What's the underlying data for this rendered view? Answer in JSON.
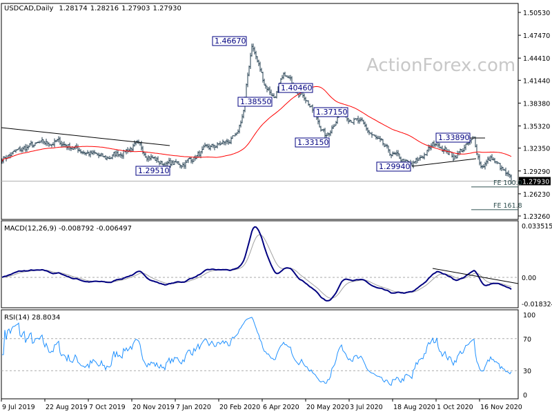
{
  "chart_data": {
    "type": "line",
    "title": "USDCAD,Daily",
    "ohlc_last": [
      "1.28174",
      "1.28216",
      "1.27903",
      "1.27930"
    ],
    "watermark": "ActionForex.com",
    "x_tick_labels": [
      "9 Jul 2019",
      "22 Aug 2019",
      "7 Oct 2019",
      "20 Nov 2019",
      "7 Jan 2020",
      "20 Feb 2020",
      "6 Apr 2020",
      "20 May 2020",
      "3 Jul 2020",
      "18 Aug 2020",
      "1 Oct 2020",
      "16 Nov 2020"
    ],
    "price_panel": {
      "y_ticks": [
        "1.50530",
        "1.47470",
        "1.44410",
        "1.41440",
        "1.38380",
        "1.35320",
        "1.32350",
        "1.29290",
        "1.26230",
        "1.23260"
      ],
      "ylim": [
        1.2326,
        1.5053
      ],
      "current_price": "1.27930",
      "close_anchors_by_bar": [
        [
          0,
          1.31
        ],
        [
          20,
          1.326
        ],
        [
          40,
          1.332
        ],
        [
          75,
          1.309
        ],
        [
          97,
          1.327
        ],
        [
          115,
          1.303
        ],
        [
          130,
          1.302
        ],
        [
          150,
          1.323
        ],
        [
          170,
          1.337
        ],
        [
          175,
          1.374
        ],
        [
          181,
          1.463
        ],
        [
          190,
          1.411
        ],
        [
          197,
          1.392
        ],
        [
          205,
          1.42
        ],
        [
          220,
          1.392
        ],
        [
          235,
          1.337
        ],
        [
          245,
          1.374
        ],
        [
          260,
          1.356
        ],
        [
          280,
          1.318
        ],
        [
          297,
          1.299
        ],
        [
          315,
          1.332
        ],
        [
          327,
          1.312
        ],
        [
          342,
          1.334
        ],
        [
          347,
          1.3
        ],
        [
          355,
          1.31
        ],
        [
          369,
          1.2793
        ]
      ],
      "moving_average_color": "#ff0000",
      "bar_color": "#1f3b4d",
      "annotations": [
        "1.46670",
        "1.38550",
        "1.40460",
        "1.37150",
        "1.33150",
        "1.29510",
        "1.29940",
        "1.33890"
      ],
      "fib_levels": [
        {
          "label": "FE 100.0",
          "price": 1.2715
        },
        {
          "label": "FE 161.8",
          "price": 1.241
        }
      ]
    },
    "macd_panel": {
      "label": "MACD(12,26,9) -0.008792 -0.006497",
      "y_ticks": [
        "0.033515",
        "0.00",
        "-0.018324"
      ],
      "ylim": [
        -0.018324,
        0.033515
      ],
      "macd_color": "#000080",
      "signal_color": "#a0a0a0"
    },
    "rsi_panel": {
      "label": "RSI(14) 28.8034",
      "y_ticks": [
        "100",
        "70",
        "30",
        "0"
      ],
      "levels": [
        70,
        30
      ],
      "ylim": [
        0,
        100
      ],
      "line_color": "#1e90ff"
    }
  }
}
